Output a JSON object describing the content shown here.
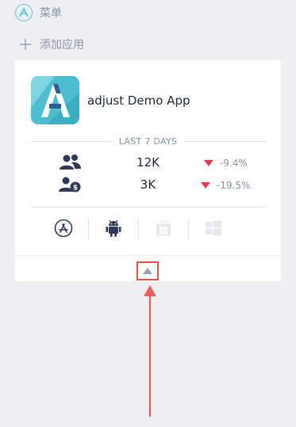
{
  "menu": {
    "label": "菜单",
    "icon": "adjust-logo-icon"
  },
  "add_app": {
    "label": "添加应用",
    "icon": "plus-icon"
  },
  "app": {
    "name": "adjust Demo App",
    "logo": "adjust-app-logo"
  },
  "period": {
    "label": "LAST 7 DAYS"
  },
  "metrics": [
    {
      "icon": "users-icon",
      "value": "12K",
      "change": "-9.4%",
      "trend": "down"
    },
    {
      "icon": "paying-users-icon",
      "value": "3K",
      "change": "-19.5%",
      "trend": "down"
    }
  ],
  "stores": [
    {
      "icon": "app-store-icon",
      "active": true
    },
    {
      "icon": "android-icon",
      "active": true
    },
    {
      "icon": "windows-store-icon",
      "active": false
    },
    {
      "icon": "windows-icon",
      "active": false
    }
  ],
  "collapse": {
    "icon": "collapse-up-icon"
  },
  "colors": {
    "background": "#efeff2",
    "accent_teal": "#59c8d6",
    "text_dark": "#232a3b",
    "text_muted": "#8a93a8",
    "negative": "#e53b54",
    "highlight": "#e2514b"
  }
}
